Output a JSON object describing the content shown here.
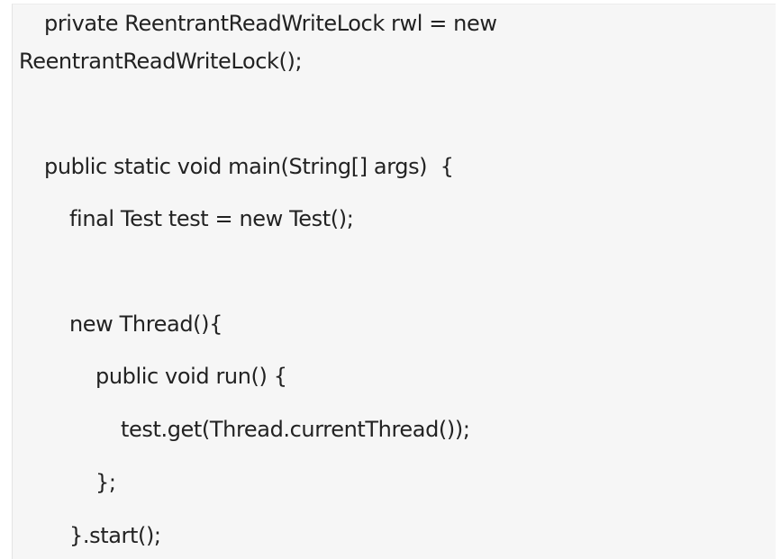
{
  "code": {
    "lines": [
      "private ReentrantReadWriteLock rwl = new",
      "ReentrantReadWriteLock();",
      "public static void main(String[] args)  {",
      "final Test test = new Test();",
      "new Thread(){",
      "public void run() {",
      "test.get(Thread.currentThread());",
      "};",
      "}.start();"
    ]
  }
}
